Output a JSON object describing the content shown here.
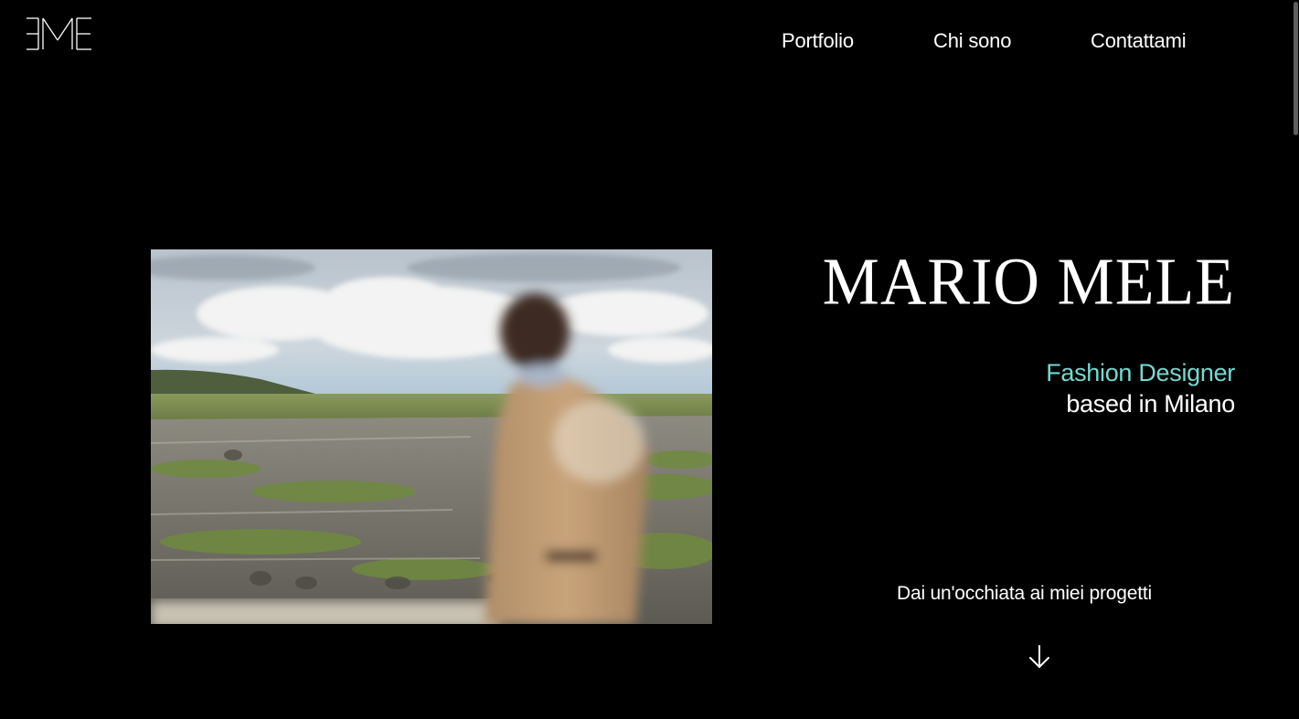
{
  "brand": {
    "logo_icon": "eme-monogram-logo"
  },
  "nav": {
    "items": [
      {
        "label": "Portfolio"
      },
      {
        "label": "Chi sono"
      },
      {
        "label": "Contattami"
      }
    ]
  },
  "hero": {
    "name": "MARIO MELE",
    "role_accent": "Fashion Designer",
    "role_sub": "based in Milano",
    "cta_label": "Dai un'occhiata ai miei progetti",
    "cta_icon": "arrow-down-icon",
    "photo_icon": "hero-photo"
  },
  "colors": {
    "background": "#000000",
    "text": "#ffffff",
    "accent": "#74d9d2"
  }
}
